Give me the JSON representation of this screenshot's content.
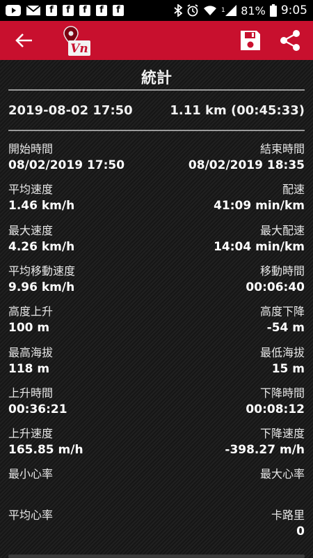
{
  "status_bar": {
    "battery": "81%",
    "time": "9:05",
    "signal_type": "1",
    "icons": [
      "youtube-icon",
      "mail-icon",
      "facebook-icon",
      "facebook-icon",
      "facebook-icon",
      "facebook-icon",
      "facebook-icon",
      "bluetooth-icon",
      "alarm-icon",
      "wifi-icon",
      "signal-icon",
      "battery-icon"
    ]
  },
  "app_bar": {
    "logo_text": "Vn",
    "colors": {
      "bar": "#c8102e",
      "pin": "#8b0000"
    }
  },
  "section": {
    "title": "統計"
  },
  "summary": {
    "datetime": "2019-08-02 17:50",
    "distance": "1.11 km (00:45:33)"
  },
  "stats": [
    {
      "left": {
        "label": "開始時間",
        "value": "08/02/2019 17:50"
      },
      "right": {
        "label": "結束時間",
        "value": "08/02/2019 18:35"
      }
    },
    {
      "left": {
        "label": "平均速度",
        "value": "1.46 km/h"
      },
      "right": {
        "label": "配速",
        "value": "41:09 min/km"
      }
    },
    {
      "left": {
        "label": "最大速度",
        "value": "4.26 km/h"
      },
      "right": {
        "label": "最大配速",
        "value": "14:04 min/km"
      }
    },
    {
      "left": {
        "label": "平均移動速度",
        "value": "9.96 km/h"
      },
      "right": {
        "label": "移動時間",
        "value": "00:06:40"
      }
    },
    {
      "left": {
        "label": "高度上升",
        "value": "100 m"
      },
      "right": {
        "label": "高度下降",
        "value": "-54 m"
      }
    },
    {
      "left": {
        "label": "最高海拔",
        "value": "118 m"
      },
      "right": {
        "label": "最低海拔",
        "value": "15 m"
      }
    },
    {
      "left": {
        "label": "上升時間",
        "value": "00:36:21"
      },
      "right": {
        "label": "下降時間",
        "value": "00:08:12"
      }
    },
    {
      "left": {
        "label": "上升速度",
        "value": "165.85 m/h"
      },
      "right": {
        "label": "下降速度",
        "value": "-398.27 m/h"
      }
    },
    {
      "left": {
        "label": "最小心率",
        "value": ""
      },
      "right": {
        "label": "最大心率",
        "value": ""
      }
    },
    {
      "left": {
        "label": "平均心率",
        "value": ""
      },
      "right": {
        "label": "卡路里",
        "value": "0"
      }
    }
  ]
}
